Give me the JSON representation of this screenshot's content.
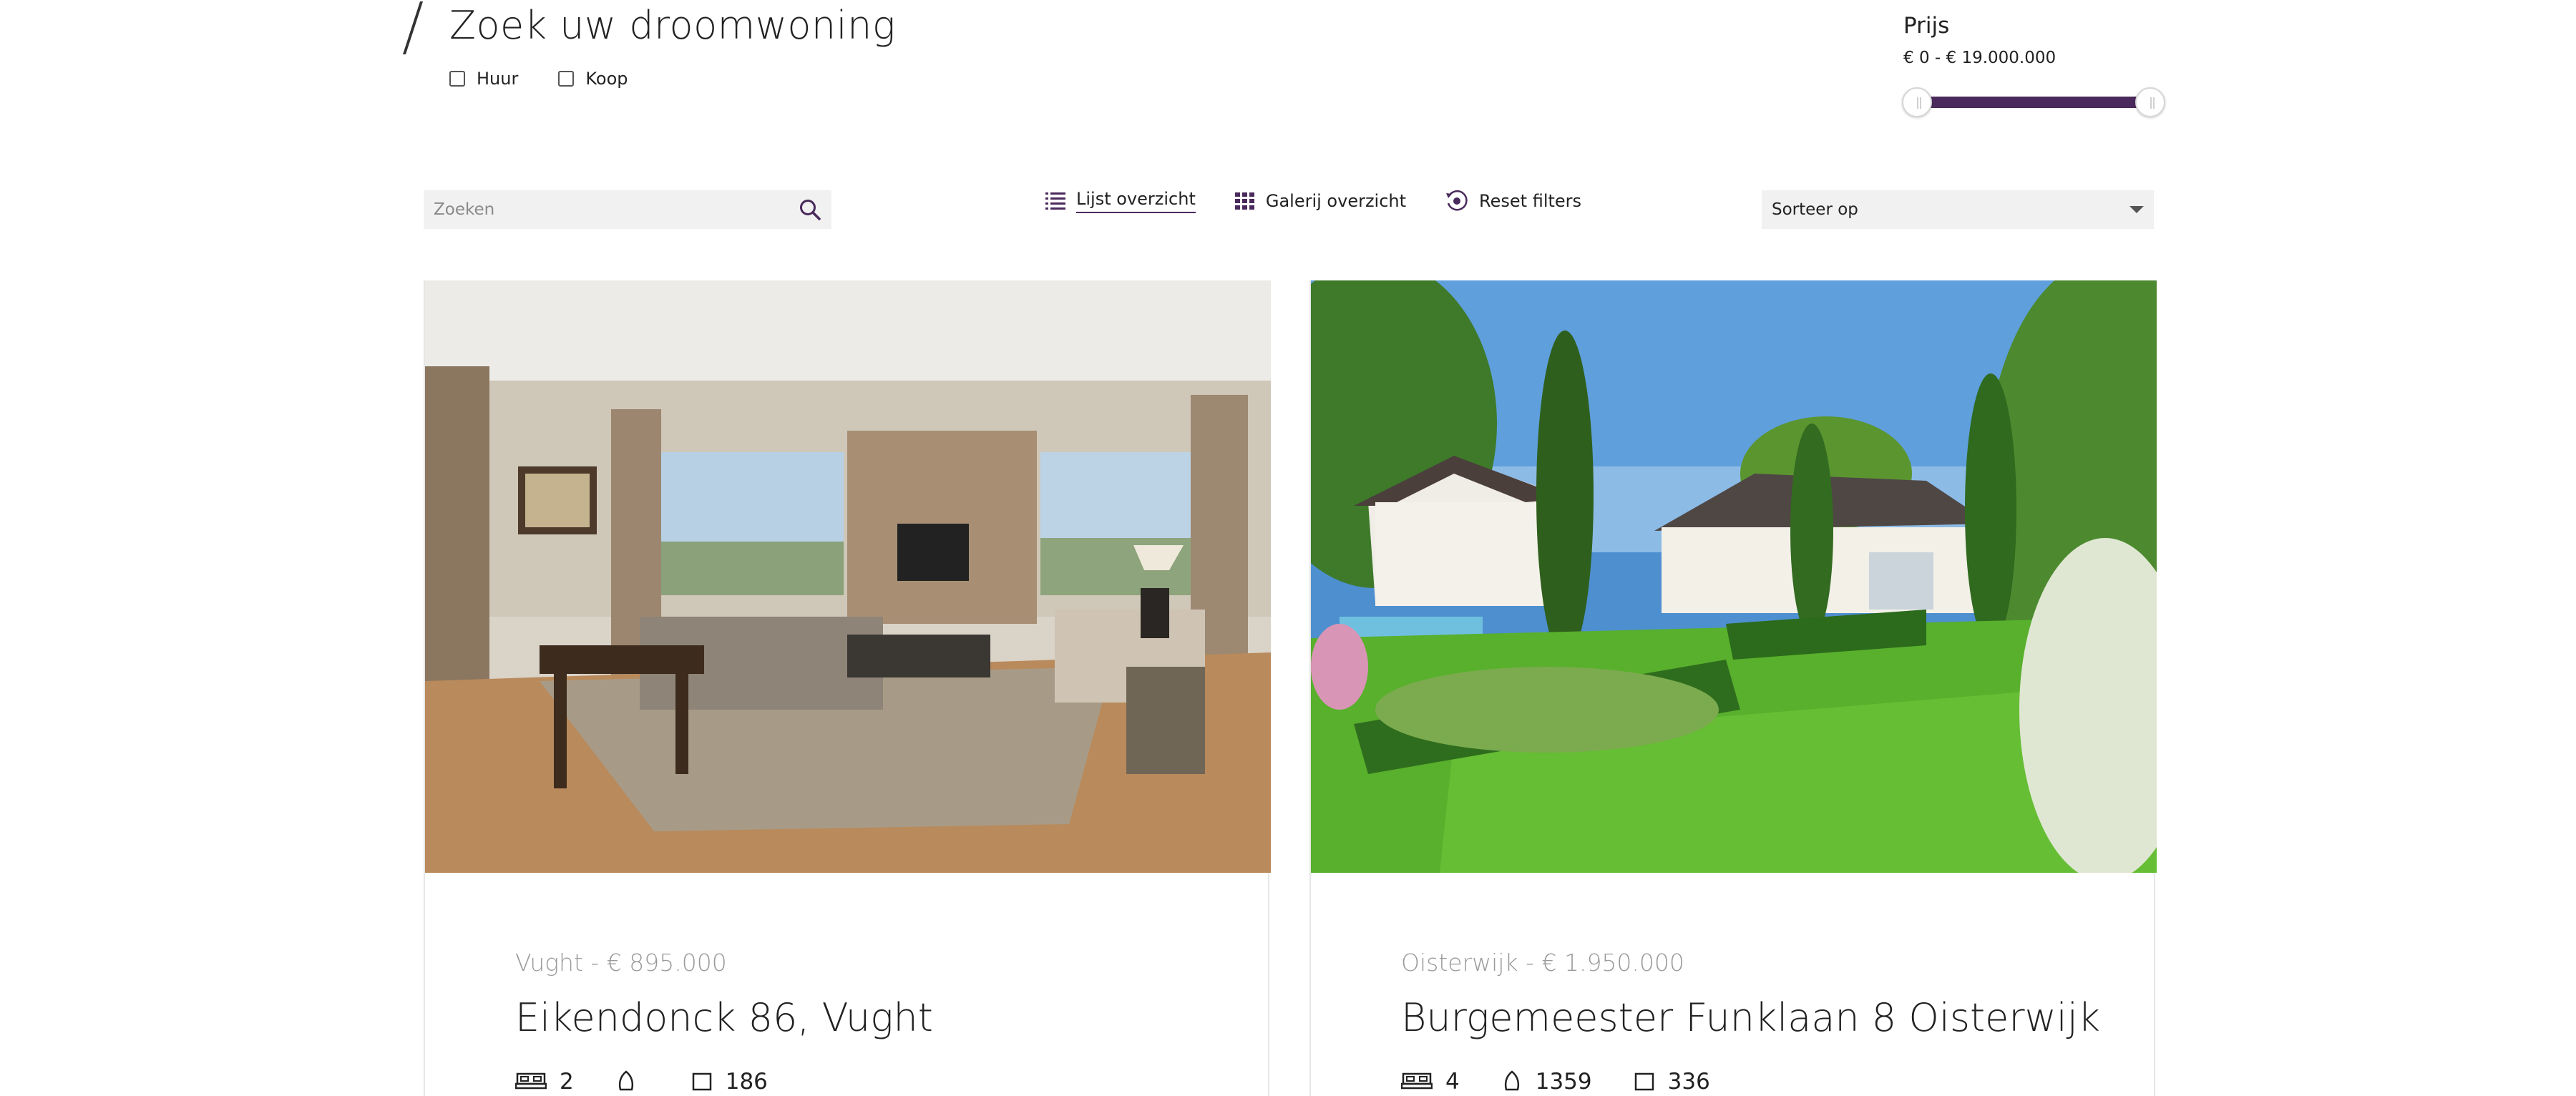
{
  "header": {
    "title": "Zoek uw droomwoning",
    "filters": [
      {
        "label": "Huur",
        "checked": false
      },
      {
        "label": "Koop",
        "checked": false
      }
    ]
  },
  "price": {
    "title": "Prijs",
    "range_text": "€ 0  -  € 19.000.000",
    "min_value": 0,
    "max_value": 19000000,
    "accent": "#4a2a5c"
  },
  "toolbar": {
    "search_placeholder": "Zoeken",
    "list_view_label": "Lijst overzicht",
    "gallery_view_label": "Galerij overzicht",
    "reset_label": "Reset filters",
    "sort_label": "Sorteer op",
    "active_view": "list"
  },
  "listings": [
    {
      "subtitle": "Vught - € 895.000",
      "name": "Eikendonck 86, Vught",
      "bedrooms": "2",
      "plot": "",
      "area": "186",
      "photo": "living-room-photo"
    },
    {
      "subtitle": "Oisterwijk - € 1.950.000",
      "name": "Burgemeester Funklaan 8 Oisterwijk",
      "bedrooms": "4",
      "plot": "1359",
      "area": "336",
      "photo": "villa-garden-photo"
    }
  ]
}
